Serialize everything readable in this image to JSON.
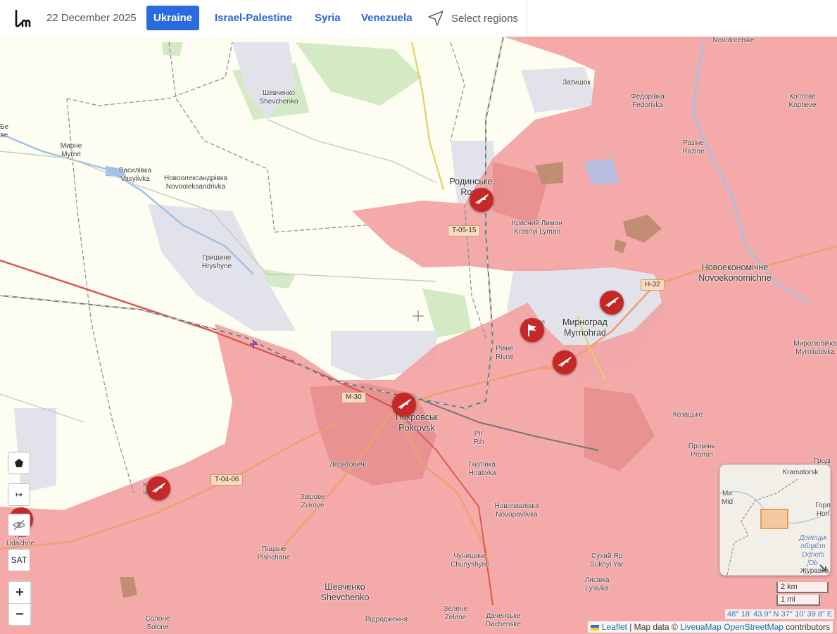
{
  "header": {
    "date": "22 December 2025",
    "tabs": [
      {
        "label": "Ukraine",
        "active": true
      },
      {
        "label": "Israel-Palestine",
        "active": false
      },
      {
        "label": "Syria",
        "active": false
      },
      {
        "label": "Venezuela",
        "active": false
      }
    ],
    "select_regions": "Select regions"
  },
  "colors": {
    "occupied": "#f3a3a3",
    "accent": "#2a6ae0",
    "marker": "#c62828",
    "land": "#fefdf2"
  },
  "places": {
    "novotoretske": "Novotoretske",
    "zatyshok": "Затишок",
    "fedorivka": "Федорівка",
    "fedorivka_en": "Fedorivka",
    "koptieve": "Коптеве",
    "koptieve_en": "Koptieve",
    "shevchenko_top": "Шевченко",
    "shevchenko_top_en": "Shevchenko",
    "myrne": "Мирне",
    "myrne_en": "Myrne",
    "vasylivka": "Василівка",
    "vasylivka_en": "Vasylivka",
    "novooleksandrivka": "Новоолександрівка",
    "novooleksandrivka_en": "Novooleksandrivka",
    "razine": "Разіне",
    "razine_en": "Razine",
    "rodynske": "Родинське",
    "rodynske_en": "Rody",
    "krasnyi_lyman": "Красний Лиман",
    "krasnyi_lyman_en": "Krasnyi Lyman",
    "hryshyne": "Гришине",
    "hryshyne_en": "Hryshyne",
    "novoekonomichne": "Новоекономічне",
    "novoekonomichne_en": "Novoekonomichne",
    "myrnohrad": "Мирноград",
    "myrnohrad_en": "Myrnohrad",
    "rivne": "Рівне",
    "rivne_en": "Rivne",
    "svitle": "Світле",
    "myroliubivka": "Миролюбівка",
    "myroliubivka_en": "Myroliubivka",
    "pokrovsk": "Покровськ",
    "pokrovsk_en": "Pokrovsk",
    "rih": "Ріг",
    "rih_en": "Rih",
    "kozatske": "Козацьке",
    "kozatske_en": "Kozatske",
    "leontovychi": "Леонтовичі",
    "hnativka": "Гнатівка",
    "hnativka_en": "Hnativka",
    "promin": "Промінь",
    "promin_en": "Promin",
    "zvirove": "Звірове",
    "zvirove_en": "Zvirove",
    "novopavlivka": "Новопавлівка",
    "novopavlivka_en": "Novopavlivka",
    "udachne": "Уда",
    "udachne_en": "Udachne",
    "pishchane": "Піщане",
    "pishchane_en": "Pishchane",
    "chunyshyne": "Чунишине",
    "chunyshyne_en": "Chunyshyne",
    "sukhyi_yar": "Сухий Яр",
    "sukhyi_yar_en": "Sukhyi Yar",
    "lysivka": "Лисівка",
    "lysivka_en": "Lysivka",
    "shevchenko_bottom": "Шевченко",
    "shevchenko_bottom_en": "Shevchenko",
    "solone": "Солоне",
    "solone_en": "Solone",
    "zelene": "Зелене",
    "zelene_en": "Zelene",
    "vidrodzhennia": "Відродження",
    "dachenske": "Даченське",
    "dachenske_en": "Dachenske",
    "hrodivka": "Гроді",
    "ko": "Ко",
    "ko2": "Ко",
    "be": "Бе",
    "ve": "ве"
  },
  "roads": {
    "t0515": "T-05-15",
    "h32": "H-32",
    "m30": "M-30",
    "t0406": "T-04-06"
  },
  "controls": {
    "polygon_icon": "pentagon-icon",
    "measure": "↦",
    "hide": "eye-slash-icon",
    "sat": "SAT",
    "zoom_in": "+",
    "zoom_out": "−"
  },
  "minimap": {
    "kramatorsk": "Kramatorsk",
    "horl": "Горл",
    "horl_en": "Horl",
    "oblast": "Донецьк",
    "oblast2": "област",
    "oblast_en": "Donets",
    "ob": "Ob",
    "mid": "Mid",
    "mid2": "Ми",
    "zhuravka": "Журавка"
  },
  "scale": {
    "km": "2 km",
    "mi": "1 mi"
  },
  "coords": "48° 18' 43.9\" N 37° 10' 39.8\" E",
  "attribution": {
    "leaflet": "Leaflet",
    "sep": " | Map data © ",
    "liveua": "LiveuaMap",
    "osm": "OpenStreetMap",
    "contributors": " contributors"
  }
}
